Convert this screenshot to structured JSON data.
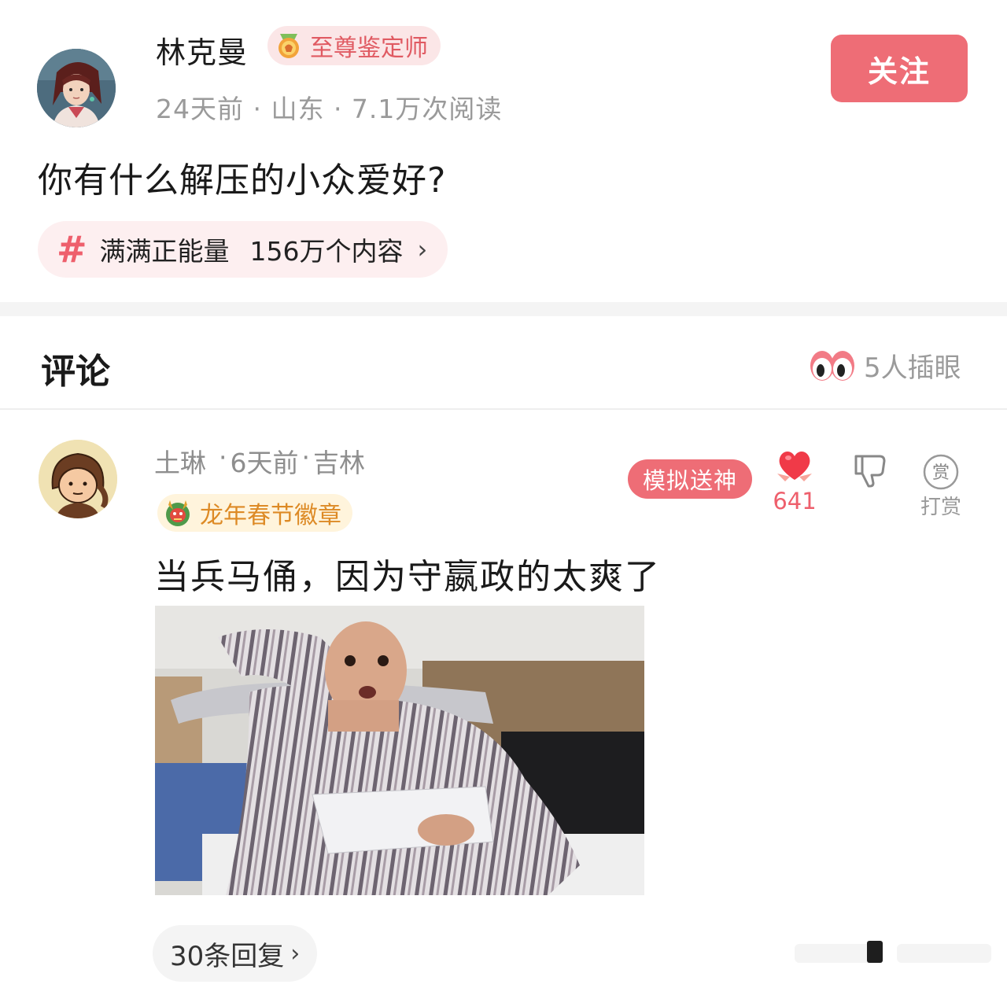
{
  "post": {
    "author": "林克曼",
    "badge": "至尊鉴定师",
    "meta": "24天前 · 山东 · 7.1万次阅读",
    "follow_label": "关注",
    "title": "你有什么解压的小众爱好?",
    "topic": {
      "name": "满满正能量",
      "count": "156万个内容",
      "hash_icon": "#",
      "chevron": "›"
    }
  },
  "comments_section": {
    "title": "评论",
    "peek_count": "5人插眼"
  },
  "comment": {
    "user": "土琳",
    "sep1": "·",
    "time": "6天前",
    "sep2": "·",
    "location": "吉林",
    "badge": "龙年春节徽章",
    "god_label": "模拟送神",
    "likes": "641",
    "tip_label": "打赏",
    "tip_glyph": "赏",
    "text": "当兵马俑，因为守嬴政的太爽了",
    "replies": "30条回复",
    "chevron": "›"
  },
  "colors": {
    "accent": "#ee6d76",
    "badge_bg": "#fbe6e7",
    "gold": "#dd8a25"
  }
}
